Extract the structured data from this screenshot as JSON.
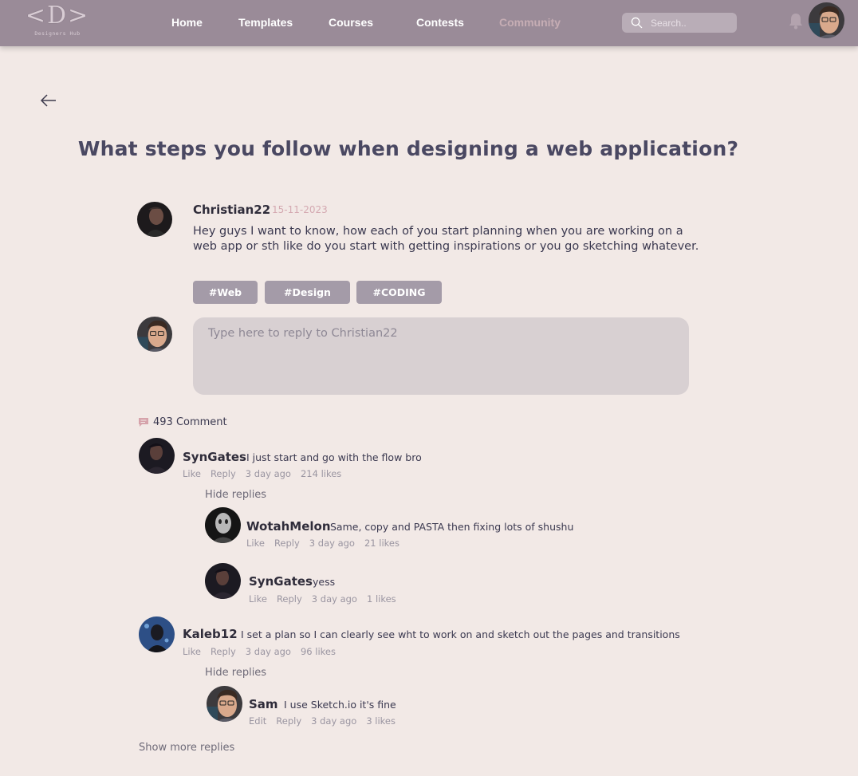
{
  "nav": {
    "logo_mark": "<D>",
    "logo_sub": "Designers Hub",
    "links": [
      "Home",
      "Templates",
      "Courses",
      "Contests",
      "Community"
    ],
    "search_placeholder": "Search.."
  },
  "post": {
    "title": "What steps you follow when designing a web application?",
    "author": "Christian22",
    "date": "15-11-2023",
    "body": "Hey guys I want to know,  how each of you start planning when you are working on a web app or sth like do you start with getting inspirations or you go sketching whatever.",
    "tags": [
      "#Web",
      "#Design",
      "#CODING"
    ],
    "reply_placeholder": "Type here to reply to Christian22"
  },
  "comments_header": "493 Comment",
  "comments": [
    {
      "name": "SynGates",
      "text": "I just start and go with the flow bro",
      "actions": [
        "Like",
        "Reply",
        "3 day ago",
        "214 likes"
      ],
      "hide_replies": "Hide replies",
      "replies": [
        {
          "name": "WotahMelon",
          "text": "Same, copy and PASTA then fixing lots of shushu",
          "actions": [
            "Like",
            "Reply",
            "3 day ago",
            "21 likes"
          ]
        },
        {
          "name": "SynGates",
          "text": "yess",
          "actions": [
            "Like",
            "Reply",
            "3 day ago",
            "1 likes"
          ]
        }
      ]
    },
    {
      "name": "Kaleb12",
      "text": "I set a plan so I can clearly see wht to work on and sketch out the pages and transitions",
      "actions": [
        "Like",
        "Reply",
        "3 day ago",
        "96 likes"
      ],
      "hide_replies": "Hide replies",
      "replies": [
        {
          "name": "Sam",
          "text": "I use Sketch.io it's fine",
          "actions": [
            "Edit",
            "Reply",
            "3 day ago",
            "3 likes"
          ]
        }
      ]
    }
  ],
  "show_more": "Show more replies",
  "colors": {
    "nav_bg": "#9a8b98",
    "page_bg": "#f2e9e6",
    "tag_bg": "#a49ba8",
    "active_link": "#c6adb4",
    "date": "#d4a9b1"
  }
}
